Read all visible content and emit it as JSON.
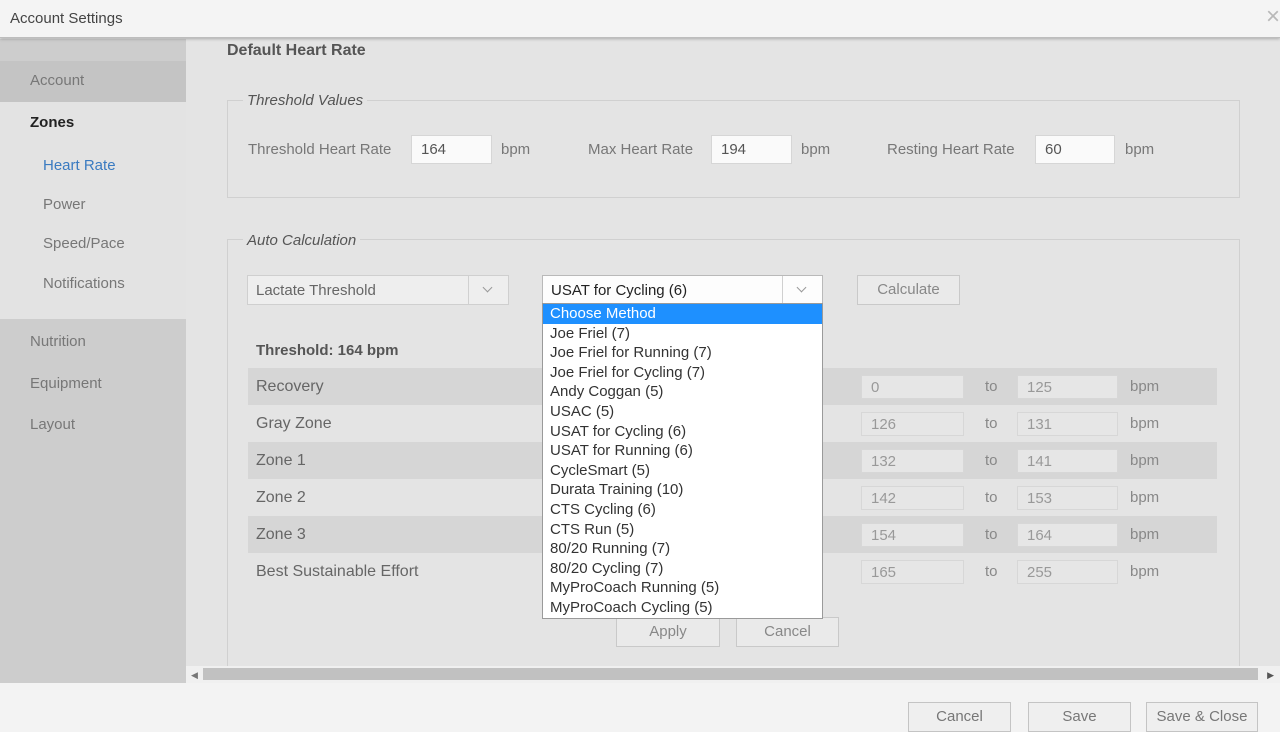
{
  "window": {
    "title": "Account Settings",
    "close_glyph": "×"
  },
  "sidebar": {
    "items": [
      {
        "label": "Account"
      },
      {
        "label": "Zones"
      },
      {
        "label": "Heart Rate"
      },
      {
        "label": "Power"
      },
      {
        "label": "Speed/Pace"
      },
      {
        "label": "Notifications"
      },
      {
        "label": "Nutrition"
      },
      {
        "label": "Equipment"
      },
      {
        "label": "Layout"
      }
    ]
  },
  "main": {
    "section_title": "Default Heart Rate",
    "threshold_values": {
      "legend": "Threshold Values",
      "threshold_label": "Threshold Heart Rate",
      "threshold_value": "164",
      "max_label": "Max Heart Rate",
      "max_value": "194",
      "resting_label": "Resting Heart Rate",
      "resting_value": "60",
      "unit": "bpm"
    },
    "auto_calc": {
      "legend": "Auto Calculation",
      "type_select": "Lactate Threshold",
      "method_select": "USAT for Cycling (6)",
      "calculate_label": "Calculate",
      "threshold_text": "Threshold: 164 bpm",
      "to_label": "to",
      "unit": "bpm",
      "zones": [
        {
          "name": "Recovery",
          "from": "0",
          "to": "125"
        },
        {
          "name": "Gray Zone",
          "from": "126",
          "to": "131"
        },
        {
          "name": "Zone 1",
          "from": "132",
          "to": "141"
        },
        {
          "name": "Zone 2",
          "from": "142",
          "to": "153"
        },
        {
          "name": "Zone 3",
          "from": "154",
          "to": "164"
        },
        {
          "name": "Best Sustainable Effort",
          "from": "165",
          "to": "255"
        }
      ],
      "apply_label": "Apply",
      "cancel_label": "Cancel"
    },
    "method_options": [
      "Choose Method",
      "Joe Friel (7)",
      "Joe Friel for Running (7)",
      "Joe Friel for Cycling (7)",
      "Andy Coggan (5)",
      "USAC (5)",
      "USAT for Cycling (6)",
      "USAT for Running (6)",
      "CycleSmart (5)",
      "Durata Training (10)",
      "CTS Cycling (6)",
      "CTS Run (5)",
      "80/20 Running (7)",
      "80/20 Cycling (7)",
      "MyProCoach Running (5)",
      "MyProCoach Cycling (5)"
    ],
    "highlighted_option": "Choose Method"
  },
  "scrollbar": {
    "left_arrow": "◀",
    "right_arrow": "▶"
  },
  "footer": {
    "cancel_label": "Cancel",
    "save_label": "Save",
    "save_close_label": "Save & Close"
  },
  "colors": {
    "accent": "#3a7bc1",
    "highlight": "#1e90ff"
  }
}
